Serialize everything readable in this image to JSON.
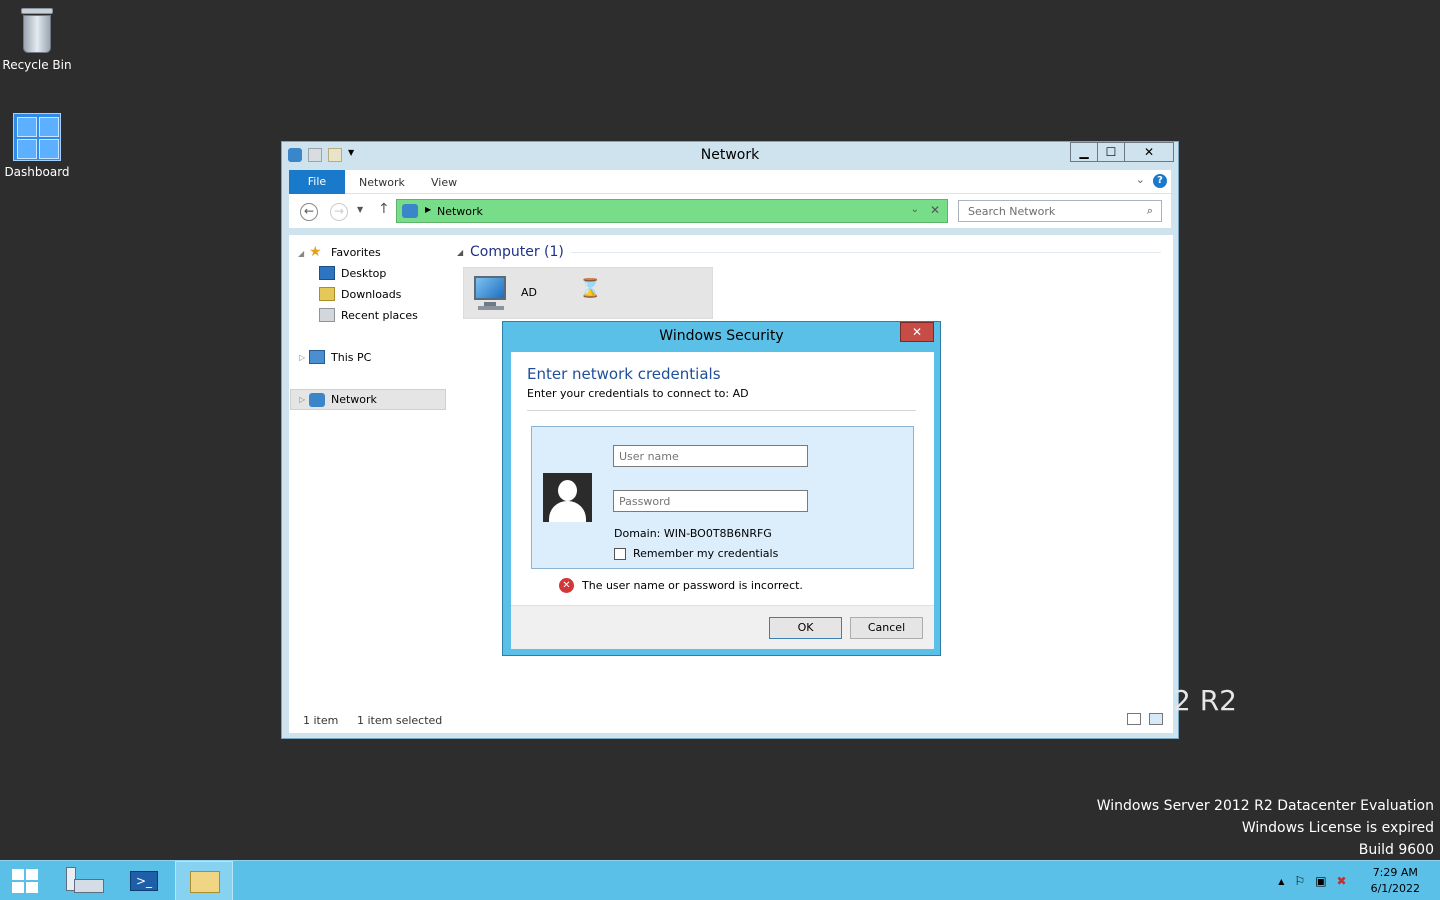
{
  "desktop": {
    "icons": [
      {
        "label": "Recycle Bin",
        "icon": "recycle-bin-icon"
      },
      {
        "label": "Dashboard",
        "icon": "dashboard-icon"
      }
    ],
    "watermark_r2": "2 R2",
    "watermark_lines": [
      "Windows Server 2012 R2 Datacenter Evaluation",
      "Windows License is expired",
      "Build 9600"
    ]
  },
  "explorer": {
    "title": "Network",
    "ribbon_tabs": {
      "file": "File",
      "network": "Network",
      "view": "View"
    },
    "help_label": "?",
    "address": "Network",
    "search_placeholder": "Search Network",
    "nav": {
      "favorites": "Favorites",
      "desktop": "Desktop",
      "downloads": "Downloads",
      "recent": "Recent places",
      "this_pc": "This PC",
      "network": "Network"
    },
    "group_header": "Computer (1)",
    "computer_name": "AD",
    "status": {
      "items": "1 item",
      "selected": "1 item selected"
    },
    "buttons": {
      "minimize": "▁",
      "maximize": "☐",
      "close": "✕"
    }
  },
  "dialog": {
    "title": "Windows Security",
    "close_label": "✕",
    "heading": "Enter network credentials",
    "subheading": "Enter your credentials to connect to: AD",
    "username_placeholder": "User name",
    "password_placeholder": "Password",
    "domain": "Domain: WIN-BO0T8B6NRFG",
    "remember": "Remember my credentials",
    "error": "The user name or password is incorrect.",
    "ok": "OK",
    "cancel": "Cancel"
  },
  "taskbar": {
    "clock_time": "7:29 AM",
    "clock_date": "6/1/2022",
    "pinned": [
      "start-icon",
      "server-manager-icon",
      "powershell-icon",
      "file-explorer-icon"
    ],
    "colors": {
      "bar": "#5bc0e8",
      "active": "#86d2f0"
    }
  }
}
